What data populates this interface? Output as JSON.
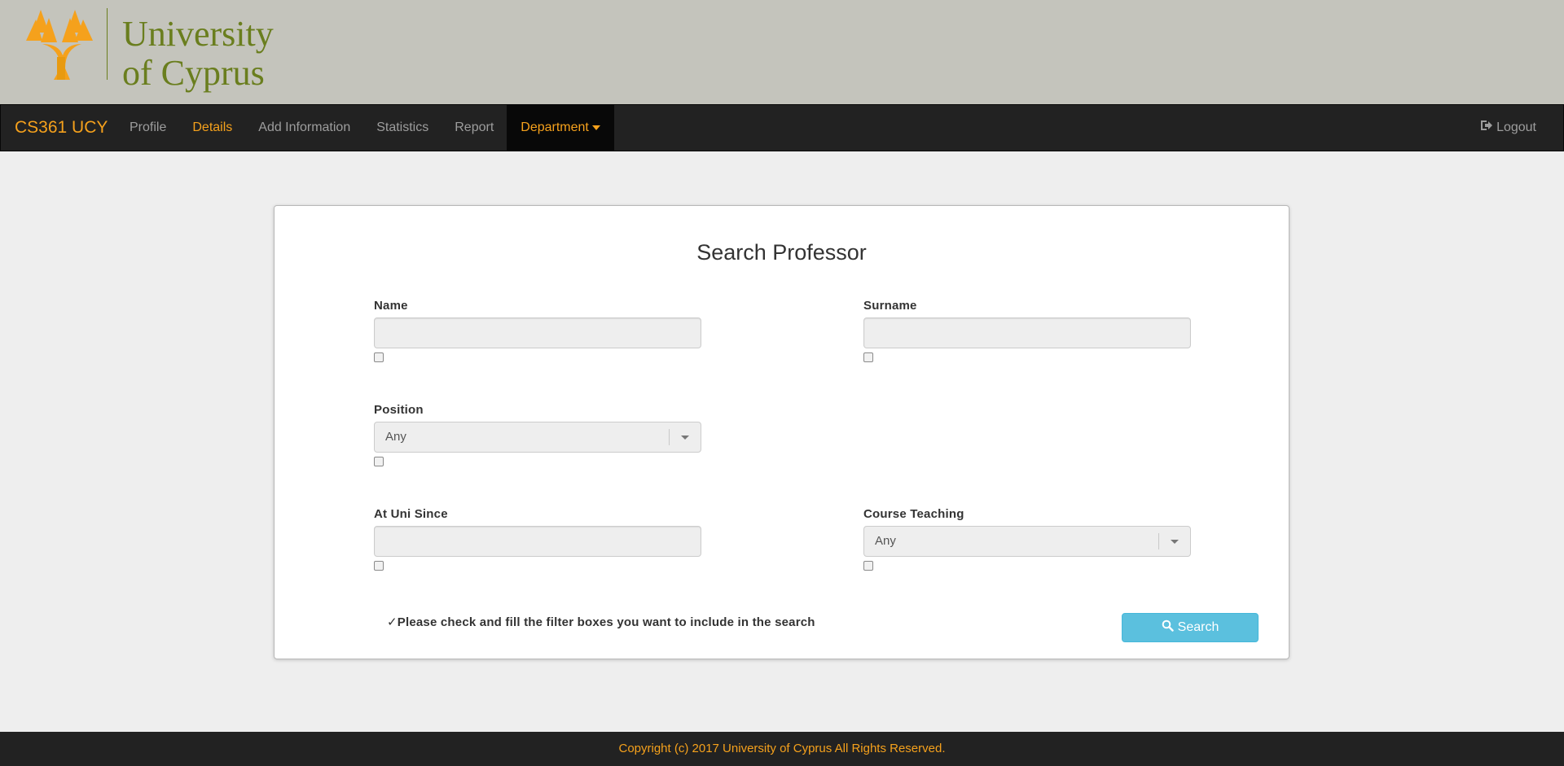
{
  "header": {
    "logo_text_line1": "University",
    "logo_text_line2": "of Cyprus"
  },
  "navbar": {
    "brand": "CS361 UCY",
    "items": [
      {
        "label": "Profile"
      },
      {
        "label": "Details"
      },
      {
        "label": "Add Information"
      },
      {
        "label": "Statistics"
      },
      {
        "label": "Report"
      },
      {
        "label": "Department"
      }
    ],
    "logout_label": "Logout"
  },
  "search_form": {
    "title": "Search Professor",
    "fields": {
      "name": {
        "label": "Name",
        "value": ""
      },
      "surname": {
        "label": "Surname",
        "value": ""
      },
      "position": {
        "label": "Position",
        "selected": "Any"
      },
      "at_uni_since": {
        "label": "At Uni Since",
        "value": ""
      },
      "course_teaching": {
        "label": "Course Teaching",
        "selected": "Any"
      }
    },
    "note": "✓Please check and fill the filter boxes you want to include in the search",
    "search_button_label": "Search"
  },
  "footer": {
    "copyright": "Copyright (c) 2017 University of Cyprus All Rights Reserved."
  },
  "colors": {
    "brand_orange": "#f5a11c",
    "logo_green": "#6a7e1e",
    "header_bg": "#c4c4bc",
    "navbar_bg": "#222222",
    "button_info": "#5bc0de"
  }
}
